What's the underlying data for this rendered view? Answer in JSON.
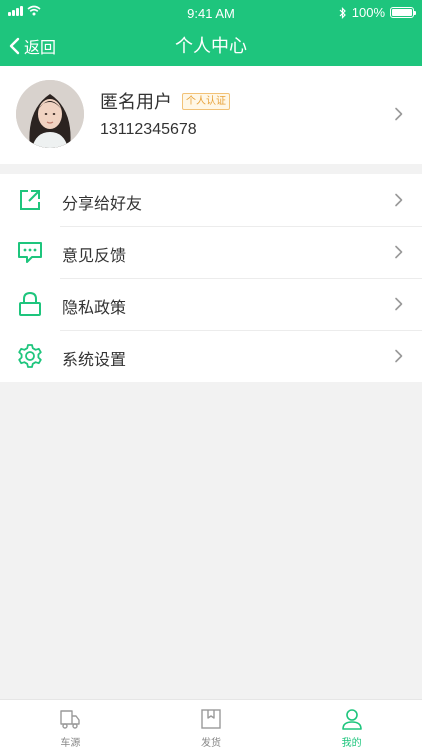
{
  "status_bar": {
    "time": "9:41 AM",
    "battery": "100%"
  },
  "nav": {
    "back_label": "返回",
    "title": "个人中心"
  },
  "profile": {
    "name": "匿名用户",
    "badge": "个人认证",
    "phone": "13112345678"
  },
  "menu": [
    {
      "label": "分享给好友",
      "icon": "share-icon"
    },
    {
      "label": "意见反馈",
      "icon": "feedback-icon"
    },
    {
      "label": "隐私政策",
      "icon": "lock-icon"
    },
    {
      "label": "系统设置",
      "icon": "gear-icon"
    }
  ],
  "tabs": [
    {
      "label": "车源",
      "icon": "truck-icon",
      "active": false
    },
    {
      "label": "发货",
      "icon": "box-icon",
      "active": false
    },
    {
      "label": "我的",
      "icon": "person-icon",
      "active": true
    }
  ],
  "colors": {
    "accent": "#1ec57d",
    "badge": "#e8a23a",
    "background": "#f2f2f2"
  }
}
